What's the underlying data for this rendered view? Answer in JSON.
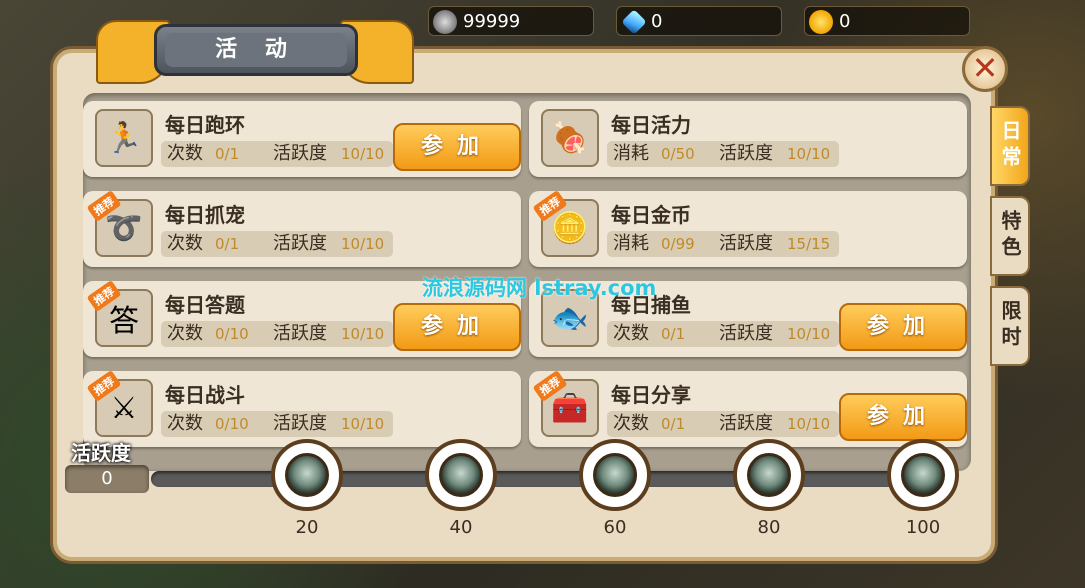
{
  "resources": {
    "silver": "99999",
    "crystal": "0",
    "gold": "0"
  },
  "panel": {
    "title": "活 动",
    "close_symbol": "✕"
  },
  "tabs": [
    {
      "label": "日常",
      "active": true
    },
    {
      "label": "特色",
      "active": false
    },
    {
      "label": "限时",
      "active": false
    }
  ],
  "activities": [
    {
      "title": "每日跑环",
      "stat1_label": "次数",
      "stat1_value": "0/1",
      "stat2_label": "活跃度",
      "stat2_value": "10/10",
      "button": "参加",
      "icon": "runner-icon",
      "icon_glyph": "🏃",
      "recommended": false
    },
    {
      "title": "每日活力",
      "stat1_label": "消耗",
      "stat1_value": "0/50",
      "stat2_label": "活跃度",
      "stat2_value": "10/10",
      "button": "",
      "icon": "meat-icon",
      "icon_glyph": "🍖",
      "recommended": false
    },
    {
      "title": "每日抓宠",
      "stat1_label": "次数",
      "stat1_value": "0/1",
      "stat2_label": "活跃度",
      "stat2_value": "10/10",
      "button": "",
      "icon": "lasso-icon",
      "icon_glyph": "➰",
      "recommended": true
    },
    {
      "title": "每日金币",
      "stat1_label": "消耗",
      "stat1_value": "0/99",
      "stat2_label": "活跃度",
      "stat2_value": "15/15",
      "button": "",
      "icon": "coin-icon",
      "icon_glyph": "🪙",
      "recommended": true
    },
    {
      "title": "每日答题",
      "stat1_label": "次数",
      "stat1_value": "0/10",
      "stat2_label": "活跃度",
      "stat2_value": "10/10",
      "button": "参加",
      "icon": "answer-icon",
      "icon_glyph": "答",
      "recommended": true
    },
    {
      "title": "每日捕鱼",
      "stat1_label": "次数",
      "stat1_value": "0/1",
      "stat2_label": "活跃度",
      "stat2_value": "10/10",
      "button": "参加",
      "icon": "fish-icon",
      "icon_glyph": "🐟",
      "recommended": false
    },
    {
      "title": "每日战斗",
      "stat1_label": "次数",
      "stat1_value": "0/10",
      "stat2_label": "活跃度",
      "stat2_value": "10/10",
      "button": "",
      "icon": "sword-icon",
      "icon_glyph": "⚔",
      "recommended": true
    },
    {
      "title": "每日分享",
      "stat1_label": "次数",
      "stat1_value": "0/1",
      "stat2_label": "活跃度",
      "stat2_value": "10/10",
      "button": "参加",
      "icon": "chest-icon",
      "icon_glyph": "🧰",
      "recommended": true
    }
  ],
  "activity_bar": {
    "label": "活跃度",
    "value": "0",
    "milestones": [
      "20",
      "40",
      "60",
      "80",
      "100"
    ]
  },
  "watermark": "流浪源码网 lstray.com"
}
